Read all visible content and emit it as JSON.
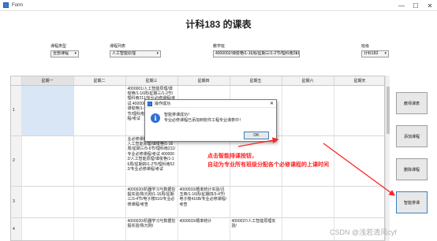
{
  "window": {
    "title": "Form",
    "minimize_glyph": "—",
    "maximize_glyph": "☐",
    "close_glyph": "✕"
  },
  "page_title": "计科183 的课表",
  "filters": {
    "course_type": {
      "label": "课程类型",
      "value": "全部课程"
    },
    "course_list": {
      "label": "课程列表",
      "value": "人工智能原理"
    },
    "teaching_class": {
      "label": "教学班",
      "value": "4000002/谭俊艳/1-16周/星期三/1-2节/理科南211"
    },
    "class": {
      "label": "班级",
      "value": "计科183"
    }
  },
  "table": {
    "headers": [
      "星期一",
      "星期二",
      "星期三",
      "星期四",
      "星期五",
      "星期六",
      "星期天"
    ],
    "rows": [
      {
        "num": "1",
        "cells": [
          "",
          "",
          "4000001/人工智能原理/谭俊艳/1-16周/星期三/1-2节/理科南211/专业必修课程/考试\n4000002/人工智能原理/谭俊艳/1-16周/星期三/1-2节/理科南211/专业必修课程/考试",
          "",
          "",
          "",
          ""
        ]
      },
      {
        "num": "2",
        "cells": [
          "",
          "",
          "业必修课程/考试\n4000002/人工智能原理/谭俊艳/1-16周/星期三/5-6节/理科南211/专业必修课程/考试\n4000002/人工智能原理/谭俊艳/1-16周/星期四/1-2节/理科南522/专业必修课程/考试",
          "",
          "",
          "",
          ""
        ]
      },
      {
        "num": "3",
        "cells": [
          "",
          "",
          "4000020/机器学习与数据挖掘实验/陈元刚/1-16周/星期三/3-4节/电子楼516/专业必修课程/考查",
          "4000033/概率统计实验/吕玉英/1-16周/星期四/3-4节/电子楼416B/专业必修课程/考查",
          "",
          "",
          ""
        ]
      },
      {
        "num": "4",
        "cells": [
          "",
          "",
          "4000020/机器学习与数据挖掘实验/陈元刚/",
          "4000033/概率统计",
          "4000037/人工智能原理实验/",
          "",
          ""
        ]
      }
    ]
  },
  "side_buttons": [
    "教师课表",
    "添加课程",
    "删除课程",
    "智能排课"
  ],
  "dialog": {
    "title": "操作成功",
    "message_line1": "智能排课成功！",
    "message_line2": "专业必修课程已添加到软件工程专业课表中！",
    "ok_label": "OK",
    "info_glyph": "i"
  },
  "annotation": {
    "line1": "点击智能排课按钮，",
    "line2": "自动为专业所有班级分配各个必修课程的上课时间",
    "color": "#ff2222"
  },
  "watermark": "CSDN @浅若清风cyf"
}
